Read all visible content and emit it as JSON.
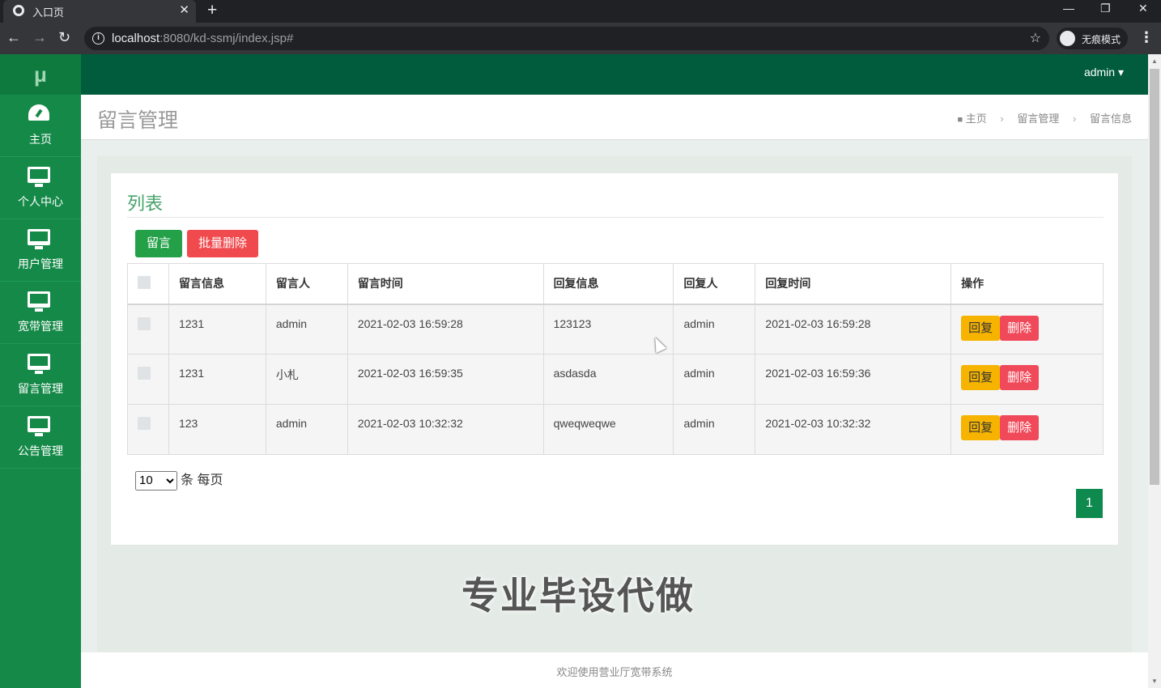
{
  "browser": {
    "tab_title": "入口页",
    "tab_close": "✕",
    "new_tab": "+",
    "minimize": "—",
    "restore": "❐",
    "close": "✕",
    "url_host": "localhost",
    "url_rest": ":8080/kd-ssmj/index.jsp#",
    "incognito_label": "无痕模式",
    "back": "←",
    "forward": "→",
    "reload": "↻",
    "star": "☆",
    "menu": "⋮"
  },
  "app": {
    "logo": "μ",
    "user": "admin ▾",
    "page_title": "留言管理",
    "footer": "欢迎使用营业厅宽带系统"
  },
  "sidebar": {
    "items": [
      {
        "label": "主页",
        "icon": "dashboard-icon"
      },
      {
        "label": "个人中心",
        "icon": "monitor-icon"
      },
      {
        "label": "用户管理",
        "icon": "monitor-icon"
      },
      {
        "label": "宽带管理",
        "icon": "monitor-icon"
      },
      {
        "label": "留言管理",
        "icon": "monitor-icon"
      },
      {
        "label": "公告管理",
        "icon": "monitor-icon"
      }
    ]
  },
  "breadcrumb": {
    "home": "主页",
    "level1": "留言管理",
    "level2": "留言信息",
    "sep": "›"
  },
  "panel": {
    "title": "列表",
    "add_label": "留言",
    "batch_delete_label": "批量删除"
  },
  "table": {
    "headers": [
      "留言信息",
      "留言人",
      "留言时间",
      "回复信息",
      "回复人",
      "回复时间",
      "操作"
    ],
    "rows": [
      {
        "message": "1231",
        "author": "admin",
        "time": "2021-02-03 16:59:28",
        "reply": "123123",
        "replier": "admin",
        "reply_time": "2021-02-03 16:59:28"
      },
      {
        "message": "1231",
        "author": "小札",
        "time": "2021-02-03 16:59:35",
        "reply": "asdasda",
        "replier": "admin",
        "reply_time": "2021-02-03 16:59:36"
      },
      {
        "message": "123",
        "author": "admin",
        "time": "2021-02-03 10:32:32",
        "reply": "qweqweqwe",
        "replier": "admin",
        "reply_time": "2021-02-03 10:32:32"
      }
    ],
    "reply_label": "回复",
    "delete_label": "删除"
  },
  "pager": {
    "page_size": "10",
    "suffix": "条 每页",
    "current_page": "1"
  },
  "watermark": "专业毕设代做"
}
